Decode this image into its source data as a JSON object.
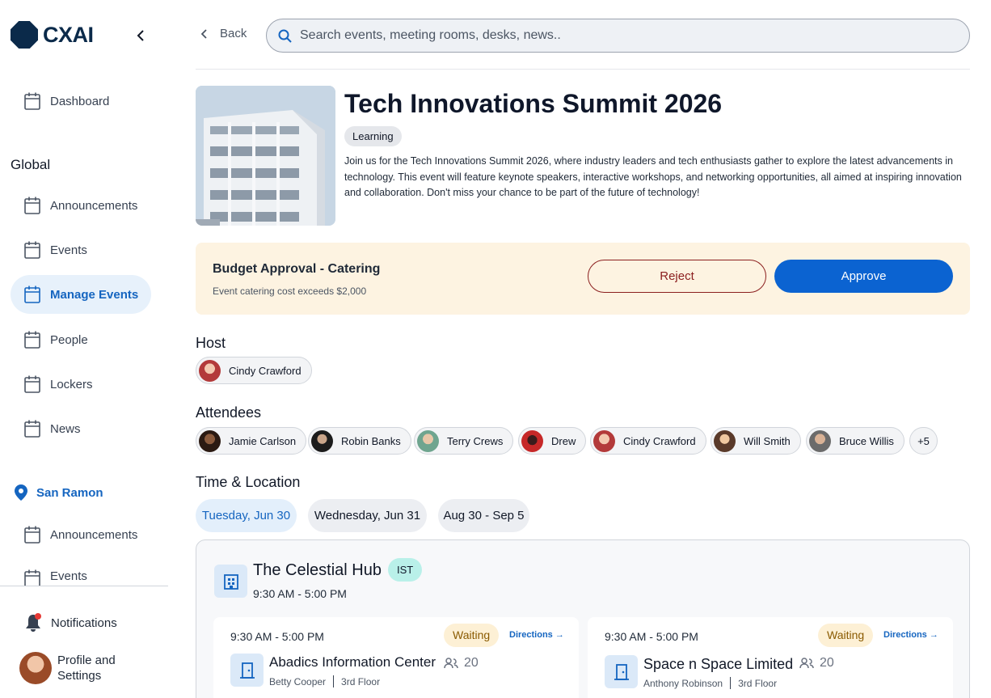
{
  "brand": {
    "name": "CXAI"
  },
  "sidebar": {
    "dashboard": "Dashboard",
    "global_label": "Global",
    "global_items": [
      {
        "label": "Announcements"
      },
      {
        "label": "Events"
      },
      {
        "label": "Manage Events",
        "active": true
      },
      {
        "label": "People"
      },
      {
        "label": "Lockers"
      },
      {
        "label": "News"
      }
    ],
    "location": "San Ramon",
    "location_items": [
      {
        "label": "Announcements"
      },
      {
        "label": "Events"
      }
    ],
    "notifications": "Notifications",
    "profile": "Profile and Settings"
  },
  "header": {
    "back": "Back",
    "search_placeholder": "Search events, meeting rooms, desks, news.."
  },
  "event": {
    "title": "Tech Innovations Summit 2026",
    "tag": "Learning",
    "description": "Join us for the Tech Innovations Summit 2026, where industry leaders and tech enthusiasts gather to explore the latest advancements in technology. This event will feature keynote speakers, interactive workshops, and networking opportunities, all aimed at inspiring innovation and collaboration. Don't miss your chance to be part of the future of technology!"
  },
  "approval": {
    "title": "Budget Approval - Catering",
    "subtitle": "Event catering cost exceeds $2,000",
    "reject": "Reject",
    "approve": "Approve"
  },
  "host": {
    "label": "Host",
    "name": "Cindy Crawford"
  },
  "attendees": {
    "label": "Attendees",
    "people": [
      "Jamie Carlson",
      "Robin Banks",
      "Terry Crews",
      "Drew",
      "Cindy Crawford",
      "Will Smith",
      "Bruce Willis"
    ],
    "more": "+5"
  },
  "time_location": {
    "label": "Time & Location",
    "dates": [
      {
        "label": "Tuesday, Jun 30",
        "active": true
      },
      {
        "label": "Wednesday, Jun 31"
      },
      {
        "label": "Aug 30 - Sep 5"
      }
    ],
    "venue": {
      "name": "The Celestial Hub",
      "timezone": "IST",
      "time": "9:30 AM - 5:00 PM"
    },
    "rooms": [
      {
        "time": "9:30 AM - 5:00 PM",
        "status": "Waiting",
        "directions": "Directions →",
        "name": "Abadics Information Center",
        "capacity": "20",
        "contact": "Betty Cooper",
        "floor": "3rd Floor"
      },
      {
        "time": "9:30 AM - 5:00 PM",
        "status": "Waiting",
        "directions": "Directions →",
        "name": "Space n Space Limited",
        "capacity": "20",
        "contact": "Anthony Robinson",
        "floor": "3rd Floor"
      }
    ]
  },
  "colors": {
    "accent": "#0b63d1",
    "active_nav_bg": "#e7f1fb",
    "approval_bg": "#fdf3e1",
    "reject": "#8b1e1e",
    "timezone_badge": "#b9f0e9",
    "status_waiting": "#fdf0d5"
  }
}
